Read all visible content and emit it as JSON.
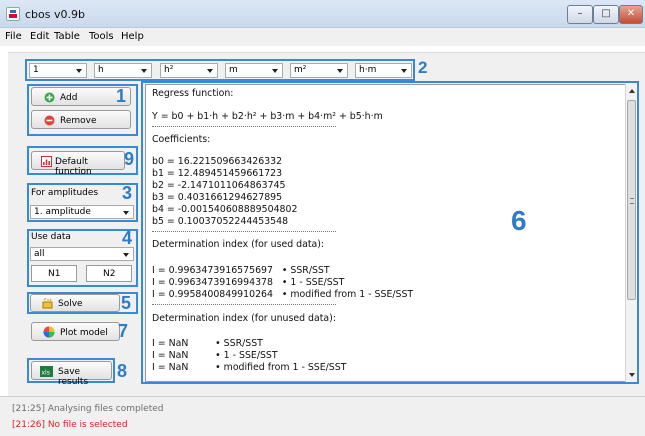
{
  "window": {
    "title": "cbos v0.9b",
    "controls": {
      "minimize": "–",
      "maximize": "□",
      "close": "✕"
    }
  },
  "menu": [
    "File",
    "Edit",
    "Table",
    "Tools",
    "Help"
  ],
  "regressors": [
    "1",
    "h",
    "h²",
    "m",
    "m²",
    "h·m"
  ],
  "buttons": {
    "add": "Add",
    "remove": "Remove",
    "default_function": "Default function",
    "solve": "Solve",
    "plot_model": "Plot model",
    "save_results": "Save results"
  },
  "amplitudes": {
    "label": "For amplitudes",
    "selected": "1. amplitude"
  },
  "use_data": {
    "label": "Use data",
    "selected": "all",
    "n1": "N1",
    "n2": "N2"
  },
  "annotations": [
    "1",
    "2",
    "3",
    "4",
    "5",
    "6",
    "7",
    "8",
    "9"
  ],
  "icons": {
    "add": "plus-circle-icon",
    "remove": "minus-circle-icon",
    "default_function": "chart-icon",
    "solve": "sparkle-icon",
    "plot_model": "color-wheel-icon",
    "save_results": "excel-icon"
  },
  "colors": {
    "annotation": "#2d7cc8",
    "error": "#e02020",
    "log": "#6e6e6e"
  },
  "results": {
    "regress_title": "Regress function:",
    "function": "Y = b0 + b1·h + b2·h² + b3·m + b4·m² + b5·h·m",
    "coefficients_title": "Coefficients:",
    "coefficients": [
      "b0 = 16.221509663426332",
      "b1 = 12.489451459661723",
      "b2 = -2.1471011064863745",
      "b3 = 0.4031661294627895",
      "b4 = -0.001540608889504802",
      "b5 = 0.10037052244453548"
    ],
    "used_title": "Determination index (for used data):",
    "used": [
      "I = 0.9963473916575697   • SSR/SST",
      "I = 0.9963473916994378   • 1 - SSE/SST",
      "I = 0.9958400849910264   • modified from 1 - SSE/SST"
    ],
    "unused_title": "Determination index (for unused data):",
    "unused": [
      "I = NaN         • SSR/SST",
      "I = NaN         • 1 - SSE/SST",
      "I = NaN         • modified from 1 - SSE/SST"
    ]
  },
  "log": [
    {
      "text": "[21:25] Analysing files completed"
    },
    {
      "text": "[21:26] No file is selected"
    }
  ]
}
